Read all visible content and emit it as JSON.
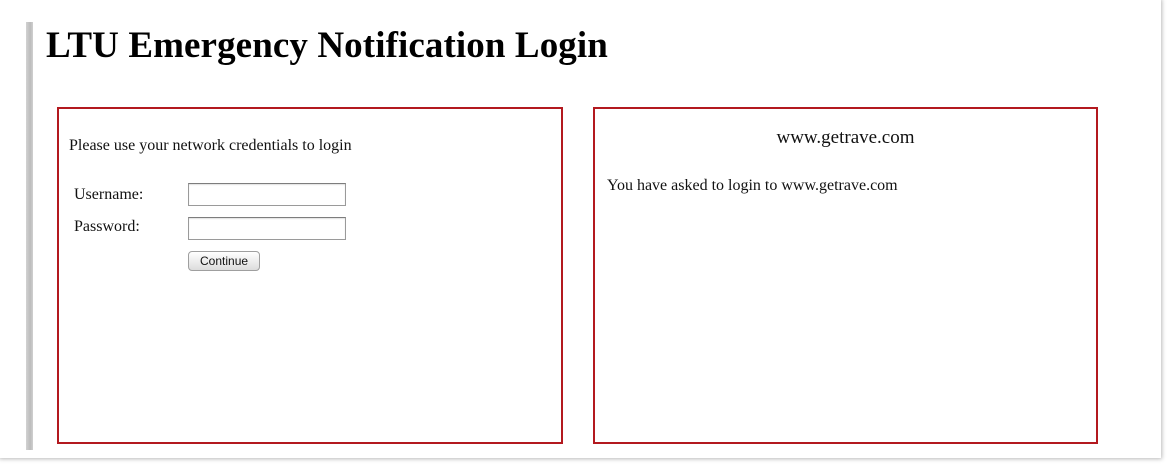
{
  "page": {
    "title": "LTU Emergency Notification Login"
  },
  "login_panel": {
    "instructions": "Please use your network credentials to login",
    "username_label": "Username:",
    "username_value": "",
    "password_label": "Password:",
    "password_value": "",
    "continue_label": "Continue"
  },
  "site_panel": {
    "site_name": "www.getrave.com",
    "message": "You have asked to login to www.getrave.com"
  },
  "colors": {
    "panel_border": "#b3191f",
    "left_rule": "#c4c4c4"
  }
}
